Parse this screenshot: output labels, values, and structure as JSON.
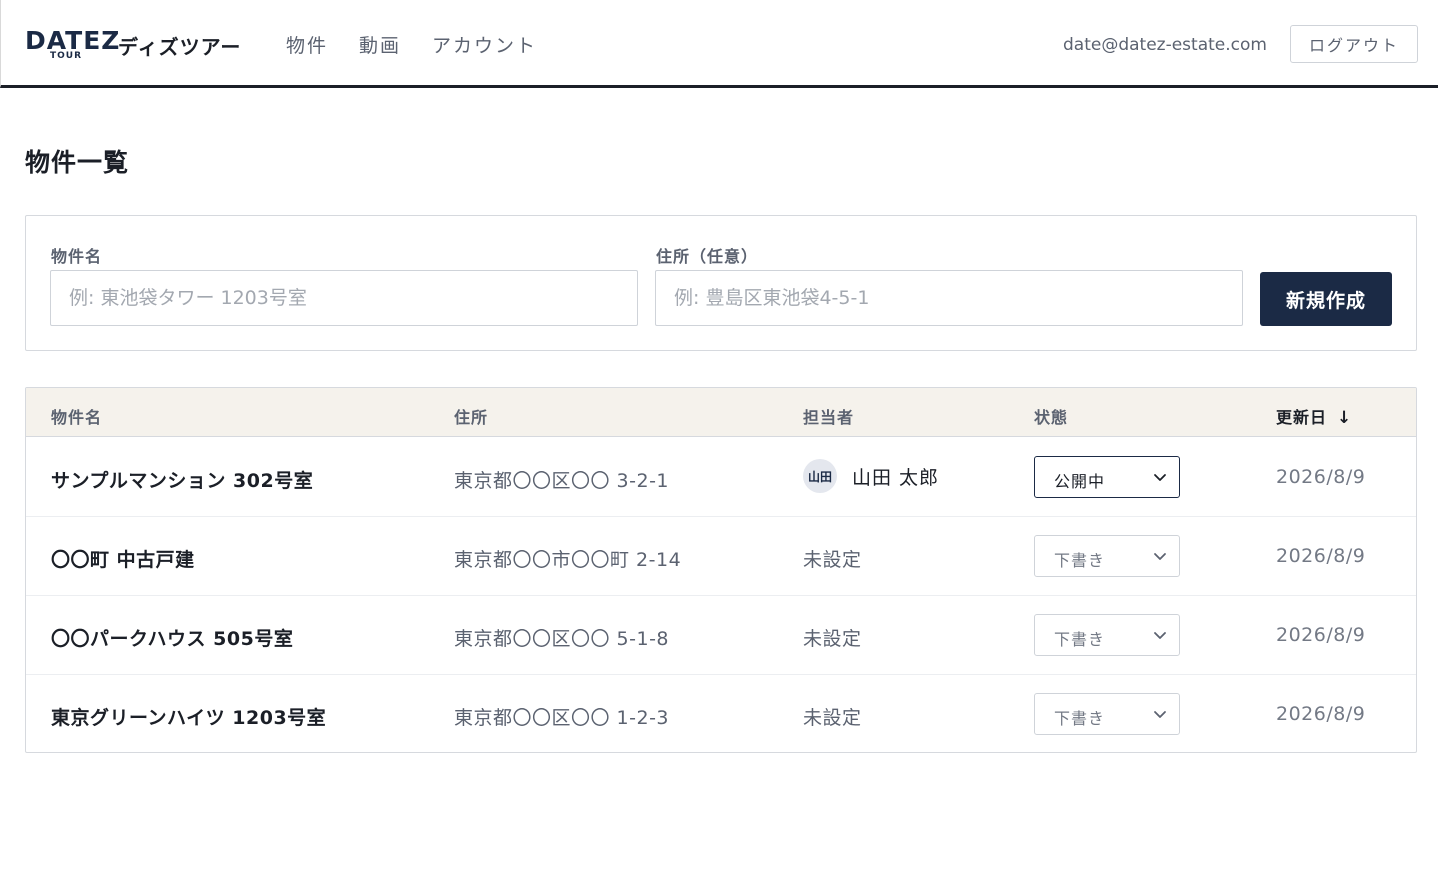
{
  "header": {
    "logo_text": "DATEZ",
    "logo_sub": "TOUR",
    "brand_name": "ディズツアー",
    "nav": [
      {
        "label": "物件"
      },
      {
        "label": "動画"
      },
      {
        "label": "アカウント"
      }
    ],
    "user_email": "date@datez-estate.com",
    "logout_label": "ログアウト"
  },
  "page_title": "物件一覧",
  "filter": {
    "name_label": "物件名",
    "name_placeholder": "例: 東池袋タワー 1203号室",
    "address_label": "住所（任意）",
    "address_placeholder": "例: 豊島区東池袋4-5-1",
    "create_label": "新規作成"
  },
  "table": {
    "columns": {
      "name": "物件名",
      "address": "住所",
      "assignee": "担当者",
      "status": "状態",
      "updated": "更新日",
      "sort_indicator": "↓"
    },
    "rows": [
      {
        "name": "サンプルマンション 302号室",
        "address": "東京都〇〇区〇〇 3-2-1",
        "avatar": "山田",
        "assignee": "山田 太郎",
        "status": "公開中",
        "updated": "2026/8/9"
      },
      {
        "name": "〇〇町 中古戸建",
        "address": "東京都〇〇市〇〇町 2-14",
        "assignee": "未設定",
        "status": "下書き",
        "updated": "2026/8/9"
      },
      {
        "name": "〇〇パークハウス 505号室",
        "address": "東京都〇〇区〇〇 5-1-8",
        "assignee": "未設定",
        "status": "下書き",
        "updated": "2026/8/9"
      },
      {
        "name": "東京グリーンハイツ 1203号室",
        "address": "東京都〇〇区〇〇 1-2-3",
        "assignee": "未設定",
        "status": "下書き",
        "updated": "2026/8/9"
      }
    ]
  },
  "colors": {
    "primary": "#1b2a45",
    "header_border": "#1b1f27",
    "table_header_bg": "#f5f2ec"
  }
}
